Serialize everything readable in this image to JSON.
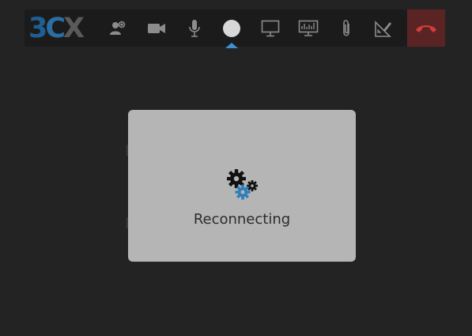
{
  "toolbar": {
    "logo_text": [
      "3",
      "C",
      "X"
    ],
    "buttons": [
      {
        "name": "add-participant-button",
        "icon": "add-user-icon"
      },
      {
        "name": "video-button",
        "icon": "video-camera-icon"
      },
      {
        "name": "microphone-button",
        "icon": "microphone-icon"
      },
      {
        "name": "record-button",
        "icon": "record-dot-icon"
      },
      {
        "name": "screen-share-button",
        "icon": "monitor-icon"
      },
      {
        "name": "presentation-button",
        "icon": "presentation-screen-icon"
      },
      {
        "name": "attach-button",
        "icon": "paperclip-icon"
      },
      {
        "name": "whiteboard-button",
        "icon": "ruler-pencil-icon"
      },
      {
        "name": "hangup-button",
        "icon": "phone-hangup-icon"
      }
    ],
    "colors": {
      "background": "#1b1b1b",
      "icon": "#8c8c8c",
      "active_indicator": "#3d8fcf",
      "hangup": "#5a2424",
      "hangup_icon": "#d23c3c"
    }
  },
  "overlay": {
    "status_text": "Reconnecting",
    "icon": "gears-icon",
    "colors": {
      "panel": "#b5b5b5",
      "text": "#2c2c2c",
      "gear_dark": "#111111",
      "gear_blue": "#2c7fb8"
    }
  }
}
